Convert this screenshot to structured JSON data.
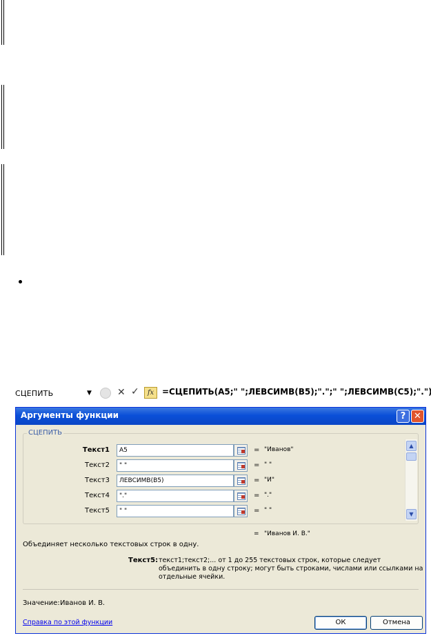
{
  "formula_bar": {
    "name_box": "СЦЕПИТЬ",
    "dropdown_icon": "triangle-down-icon",
    "cancel_symbol": "✕",
    "enter_symbol": "✓",
    "fx_label": "fx",
    "formula": "=СЦЕПИТЬ(A5;\" \";ЛЕВСИМВ(B5);\".\";\" \";ЛЕВСИМВ(C5);\".\")"
  },
  "dialog": {
    "title": "Аргументы функции",
    "help_button": "?",
    "close_button": "✕",
    "group_label": "СЦЕПИТЬ",
    "arguments": [
      {
        "label": "Текст1",
        "value": "A5",
        "result": "\"Иванов\""
      },
      {
        "label": "Текст2",
        "value": "\" \"",
        "result": "\" \""
      },
      {
        "label": "Текст3",
        "value": "ЛЕВСИМВ(B5)",
        "result": "\"И\""
      },
      {
        "label": "Текст4",
        "value": "\".\"",
        "result": "\".\""
      },
      {
        "label": "Текст5",
        "value": "\" \"",
        "result": "\" \""
      }
    ],
    "equals_sign": "=",
    "overall_result": "\"Иванов И. В.\"",
    "description": "Объединяет несколько текстовых строк в одну.",
    "active_arg_name": "Текст5:",
    "active_arg_description": "текст1;текст2;... от 1 до 255 текстовых строк, которые следует объединить в одну строку; могут быть строками, числами или ссылками на отдельные ячейки.",
    "value_label": "Значение:",
    "value_text": "Иванов И. В.",
    "help_link": "Справка по этой функции",
    "ok_label": "ОК",
    "cancel_label": "Отмена"
  }
}
